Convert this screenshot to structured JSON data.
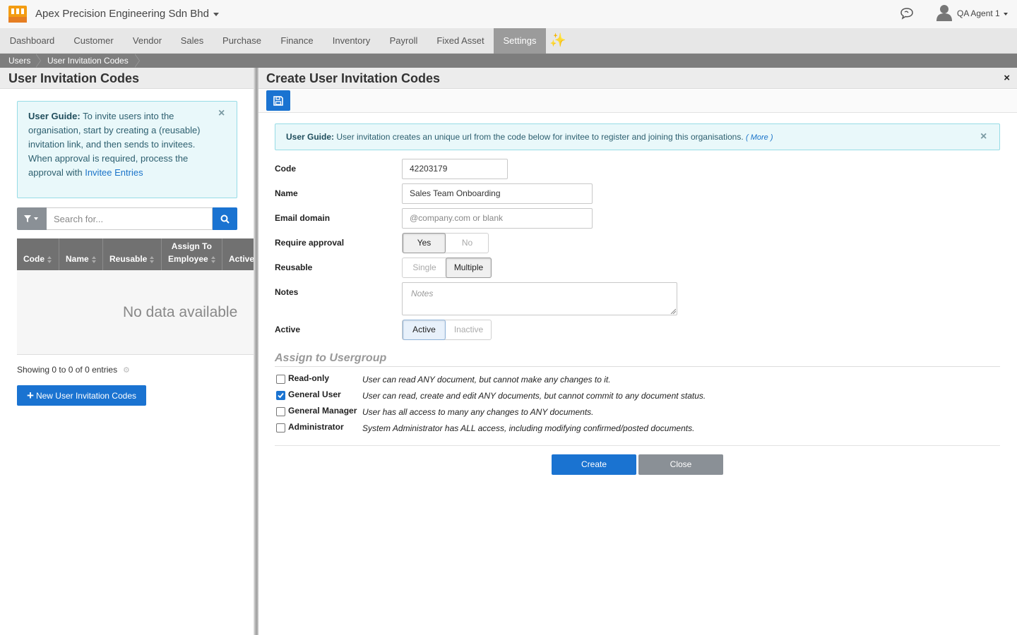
{
  "header": {
    "company": "Apex Precision Engineering Sdn Bhd",
    "user": "QA Agent 1"
  },
  "nav": {
    "items": [
      "Dashboard",
      "Customer",
      "Vendor",
      "Sales",
      "Purchase",
      "Finance",
      "Inventory",
      "Payroll",
      "Fixed Asset",
      "Settings"
    ],
    "active": "Settings"
  },
  "breadcrumb": [
    "Users",
    "User Invitation Codes"
  ],
  "left": {
    "title": "User Invitation Codes",
    "guide": {
      "label": "User Guide:",
      "text1": " To invite users into the organisation, start by creating a (reusable) invitation link, and then sends to invitees.",
      "text2": "When approval is required, process the approval with ",
      "link": "Invitee Entries"
    },
    "search": {
      "placeholder": "Search for..."
    },
    "table": {
      "columns": [
        "Code",
        "Name",
        "Reusable",
        "Assign To Employee",
        "Active"
      ],
      "col_assign_1": "Assign To",
      "col_assign_2": "Employee",
      "empty": "No data available",
      "showing": "Showing 0 to 0 of 0 entries"
    },
    "new_button": "New User Invitation Codes"
  },
  "form": {
    "title": "Create User Invitation Codes",
    "guide": {
      "label": "User Guide:",
      "text": " User invitation creates an unique url from the code below for invitee to register and joining this organisations. ",
      "more": "( More )"
    },
    "fields": {
      "code": {
        "label": "Code",
        "value": "42203179"
      },
      "name": {
        "label": "Name",
        "value": "Sales Team Onboarding"
      },
      "email": {
        "label": "Email domain",
        "placeholder": "@company.com or blank"
      },
      "approval": {
        "label": "Require approval",
        "options": [
          "Yes",
          "No"
        ],
        "selected": "Yes"
      },
      "reusable": {
        "label": "Reusable",
        "options": [
          "Single",
          "Multiple"
        ],
        "selected": "Multiple"
      },
      "notes": {
        "label": "Notes",
        "placeholder": "Notes"
      },
      "active": {
        "label": "Active",
        "options": [
          "Active",
          "Inactive"
        ],
        "selected": "Active"
      }
    },
    "usergroup": {
      "title": "Assign to Usergroup",
      "groups": [
        {
          "name": "Read-only",
          "desc": "User can read ANY document, but cannot make any changes to it.",
          "checked": false
        },
        {
          "name": "General User",
          "desc": "User can read, create and edit ANY documents, but cannot commit to any document status.",
          "checked": true
        },
        {
          "name": "General Manager",
          "desc": "User has all access to many any changes to ANY documents.",
          "checked": false
        },
        {
          "name": "Administrator",
          "desc": "System Administrator has ALL access, including modifying confirmed/posted documents.",
          "checked": false
        }
      ]
    },
    "buttons": {
      "create": "Create",
      "close": "Close"
    }
  },
  "colors": {
    "primary": "#1a73d1",
    "secondary": "#8a9096",
    "guide_bg": "#e9f8fa",
    "nav_active": "#9b9b9b"
  }
}
